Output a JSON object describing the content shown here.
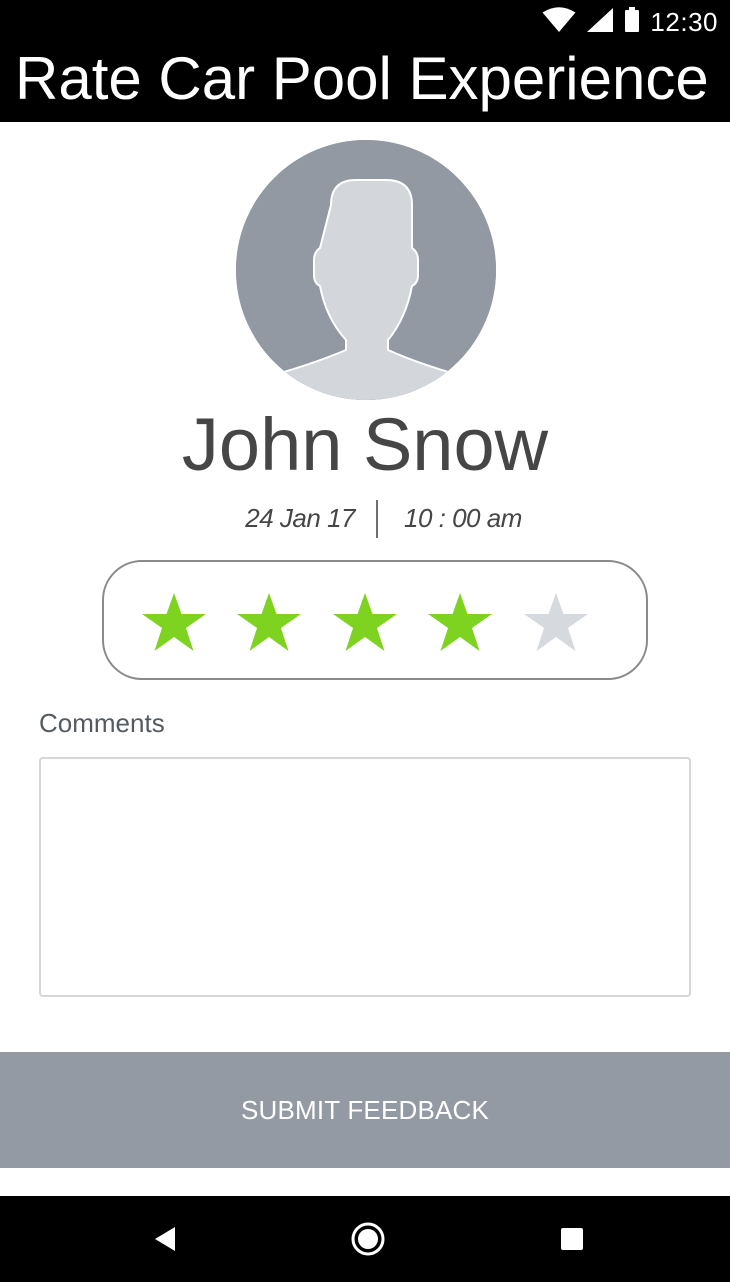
{
  "status_bar": {
    "time": "12:30",
    "icons": [
      "wifi-icon",
      "cell-signal-icon",
      "battery-icon"
    ]
  },
  "app_bar": {
    "title": "Rate Car Pool Experience"
  },
  "driver": {
    "name": "John Snow",
    "avatar_icon": "person-silhouette-icon"
  },
  "trip": {
    "date": "24 Jan 17",
    "time": "10 : 00 am"
  },
  "rating": {
    "value": 4,
    "max": 5,
    "filled_color": "#7ed321",
    "empty_color": "#d6d9de"
  },
  "comments": {
    "label": "Comments",
    "value": "",
    "placeholder": ""
  },
  "submit": {
    "label": "SUBMIT FEEDBACK",
    "background": "#949aa3"
  },
  "nav_bar": {
    "buttons": [
      "back-icon",
      "home-icon",
      "recents-icon"
    ]
  }
}
